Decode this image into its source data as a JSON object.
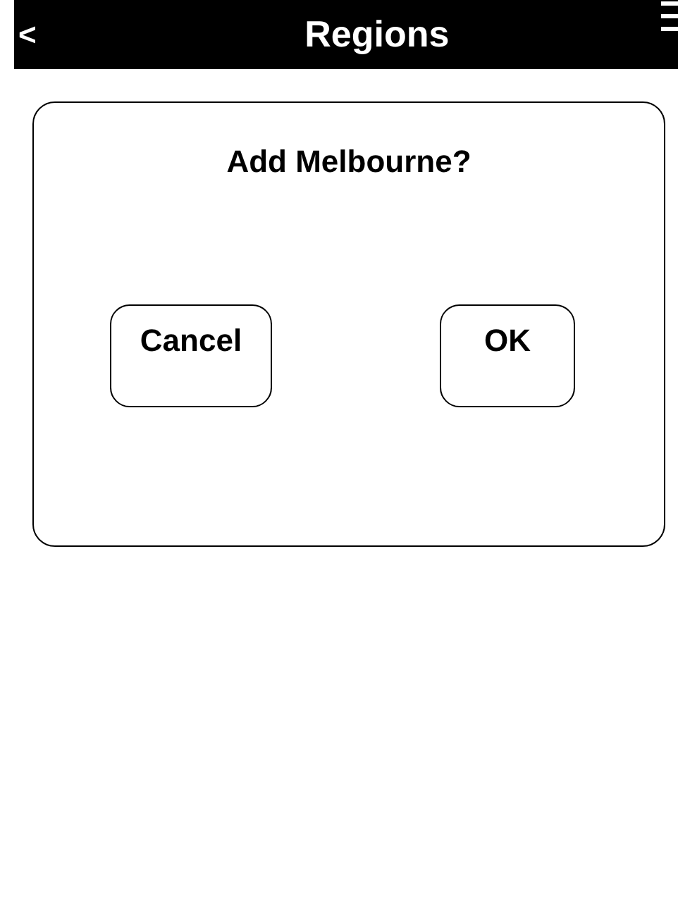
{
  "header": {
    "back": "<",
    "title": "Regions"
  },
  "dialog": {
    "message": "Add Melbourne?",
    "buttons": [
      {
        "label": "Cancel"
      },
      {
        "label": "OK"
      }
    ]
  }
}
